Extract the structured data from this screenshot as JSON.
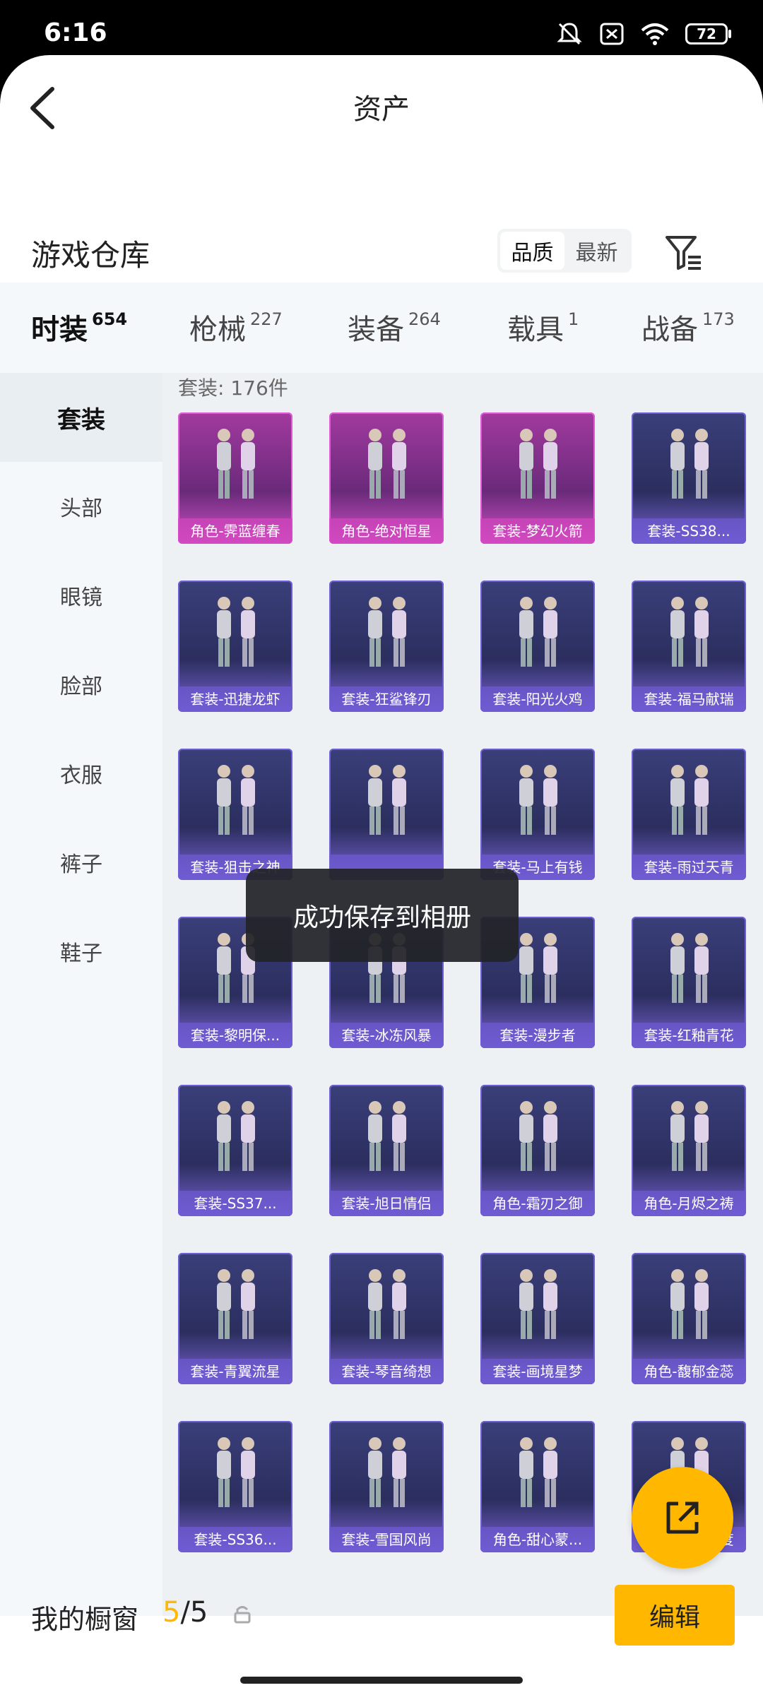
{
  "status_bar": {
    "time": "6:16",
    "battery": "72"
  },
  "header": {
    "title": "资产"
  },
  "warehouse": {
    "title": "游戏仓库",
    "sort_options": [
      "品质",
      "最新"
    ],
    "active_sort": "品质"
  },
  "tabs": [
    {
      "label": "时装",
      "count": "654",
      "active": true
    },
    {
      "label": "枪械",
      "count": "227"
    },
    {
      "label": "装备",
      "count": "264"
    },
    {
      "label": "载具",
      "count": "1"
    },
    {
      "label": "战备",
      "count": "173"
    }
  ],
  "sidebar": {
    "items": [
      "套装",
      "头部",
      "眼镜",
      "脸部",
      "衣服",
      "裤子",
      "鞋子"
    ],
    "active": "套装"
  },
  "content": {
    "count_label": "套装: 176件",
    "items": [
      {
        "name": "角色-霁蓝缠春",
        "rarity": "pink"
      },
      {
        "name": "角色-绝对恒星",
        "rarity": "pink"
      },
      {
        "name": "套装-梦幻火箭",
        "rarity": "pink"
      },
      {
        "name": "套装-SS38...",
        "rarity": "purple"
      },
      {
        "name": "套装-迅捷龙虾",
        "rarity": "purple"
      },
      {
        "name": "套装-狂鲨锋刃",
        "rarity": "purple"
      },
      {
        "name": "套装-阳光火鸡",
        "rarity": "purple"
      },
      {
        "name": "套装-福马献瑞",
        "rarity": "purple"
      },
      {
        "name": "套装-狙击之神",
        "rarity": "purple"
      },
      {
        "name": "",
        "rarity": "purple"
      },
      {
        "name": "套装-马上有钱",
        "rarity": "purple"
      },
      {
        "name": "套装-雨过天青",
        "rarity": "purple"
      },
      {
        "name": "套装-黎明保...",
        "rarity": "purple"
      },
      {
        "name": "套装-冰冻风暴",
        "rarity": "purple"
      },
      {
        "name": "套装-漫步者",
        "rarity": "purple"
      },
      {
        "name": "套装-红釉青花",
        "rarity": "purple"
      },
      {
        "name": "套装-SS37...",
        "rarity": "purple"
      },
      {
        "name": "套装-旭日情侣",
        "rarity": "purple"
      },
      {
        "name": "角色-霜刃之御",
        "rarity": "purple"
      },
      {
        "name": "角色-月烬之祷",
        "rarity": "purple"
      },
      {
        "name": "套装-青翼流星",
        "rarity": "purple"
      },
      {
        "name": "套装-琴音绮想",
        "rarity": "purple"
      },
      {
        "name": "套装-画境星梦",
        "rarity": "purple"
      },
      {
        "name": "角色-馥郁金蕊",
        "rarity": "purple"
      },
      {
        "name": "套装-SS36...",
        "rarity": "purple"
      },
      {
        "name": "套装-雪国风尚",
        "rarity": "purple"
      },
      {
        "name": "角色-甜心蒙...",
        "rarity": "purple"
      },
      {
        "name": "角色-超感刻度",
        "rarity": "purple"
      }
    ]
  },
  "toast": {
    "text": "成功保存到相册"
  },
  "showcase": {
    "label": "我的橱窗",
    "current": "5",
    "total": "/5",
    "edit_label": "编辑"
  }
}
